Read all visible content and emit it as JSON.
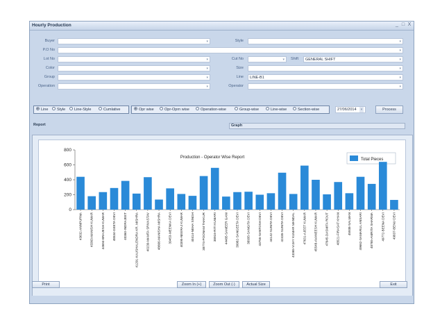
{
  "window": {
    "title": "Hourly Production",
    "minimize": "_",
    "maximize": "□",
    "close": "X"
  },
  "form": {
    "buyer_label": "Buyer",
    "buyer_value": "",
    "style_label": "Style",
    "style_value": "",
    "po_label": "P.O No",
    "po_value": "",
    "lot_label": "Lot No",
    "lot_value": "",
    "cut_label": "Cut No",
    "cut_value": "",
    "shift_label": "Shift",
    "shift_value": "GENERAL SHIFT",
    "color_label": "Color",
    "color_value": "",
    "size_label": "Size",
    "size_value": "",
    "group_label": "Group",
    "group_value": "",
    "line_label": "Line",
    "line_value": "LINE-B1",
    "operation_label": "Operation",
    "operation_value": "",
    "operator_label": "Operator",
    "operator_value": ""
  },
  "view_options": [
    {
      "label": "Line",
      "selected": true
    },
    {
      "label": "Style",
      "selected": false
    },
    {
      "label": "Line-Style",
      "selected": false
    },
    {
      "label": "Cumlative",
      "selected": false
    }
  ],
  "report_options": [
    {
      "label": "Opr wise",
      "selected": true
    },
    {
      "label": "Opr-Oprn wise",
      "selected": false
    },
    {
      "label": "Operation-wise",
      "selected": false
    },
    {
      "label": "Group-wise",
      "selected": false
    },
    {
      "label": "Line-wise",
      "selected": false
    },
    {
      "label": "Section-wise",
      "selected": false
    }
  ],
  "date_value": "27/06/2014",
  "process_label": "Process",
  "tabs": {
    "report": "Report",
    "graph": "Graph"
  },
  "footer": {
    "print": "Print",
    "zoom_in": "Zoom In (+)",
    "zoom_out": "Zoom Out (-)",
    "actual_size": "Actual Size",
    "exit": "Exit"
  },
  "colors": {
    "bar": "#2a8ad8",
    "window_bg": "#c9d7ea",
    "accent": "#1f2f48"
  },
  "icons": {
    "dropdown": "chevron-down-icon",
    "calendar": "calendar-dropdown-icon"
  },
  "chart_data": {
    "type": "bar",
    "title": "Production - Operator Wise Report",
    "legend": "top-right",
    "grid": false,
    "ylim": [
      0,
      800
    ],
    "yticks": [
      0,
      200,
      400,
      600,
      800
    ],
    "series": [
      {
        "name": "Total Pieces",
        "values": [
          440,
          180,
          235,
          290,
          385,
          215,
          435,
          135,
          285,
          210,
          185,
          450,
          560,
          175,
          235,
          240,
          200,
          220,
          495,
          210,
          590,
          400,
          205,
          370,
          220,
          440,
          345,
          640,
          130
        ]
      }
    ],
    "categories": [
      "43632-ANNPURNA",
      "43363-MANISH KUMAR",
      "44694-BRAJESH KUMAR",
      "48534-GEETA DEVI",
      "40360-INDRAJEET",
      "41291-KAUSHALENDRA KR. MISHRA",
      "40239-MAMTA SRIVASTAV",
      "48666-MANISHA MISHRA",
      "39453-MEENKA DEVI",
      "40395-NEERAJ KUMAR",
      "40414-NEHA SINGH",
      "38774-POONAM THAKUR",
      "38916-RITI KUMARI",
      "44485-SAMEER GANI",
      "39982-SANGEETA DEVI",
      "38935-SANGITA DEVI",
      "43755-SANTOSH DEVI",
      "44142-SUNITA DEVI",
      "42435-SUNITA DEVI",
      "43365-VIJAY KUMAR MANDAL",
      "47631-AJEET KUMAR",
      "45548-AVANEESH KUMAR",
      "47645-DASMITA ROUT",
      "48521-FIRASAT KHAN",
      "45938-SALMAN",
      "49662-SAMARUL ANSARI",
      "48765-AMRITA SHARMA",
      "49772-BEENA DEVI",
      "49837-BENU DEVI"
    ]
  }
}
